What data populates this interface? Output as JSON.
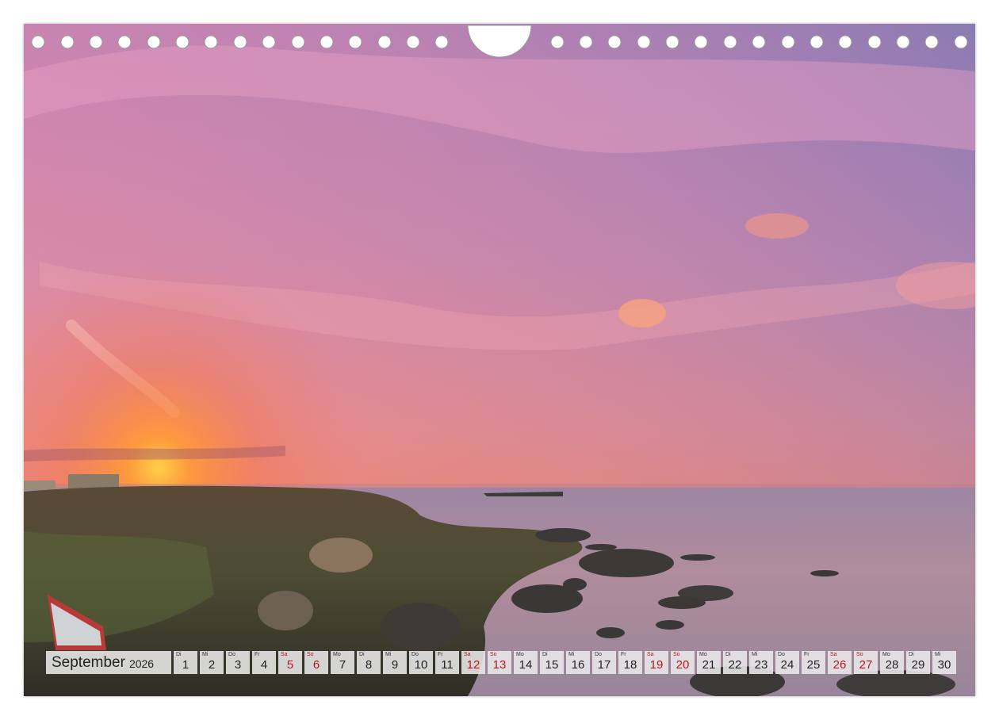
{
  "calendar": {
    "month": "September",
    "year": "2026",
    "weekend_color": "#c0141c",
    "days": [
      {
        "wd": "Di",
        "d": "1",
        "we": false
      },
      {
        "wd": "Mi",
        "d": "2",
        "we": false
      },
      {
        "wd": "Do",
        "d": "3",
        "we": false
      },
      {
        "wd": "Fr",
        "d": "4",
        "we": false
      },
      {
        "wd": "Sa",
        "d": "5",
        "we": true
      },
      {
        "wd": "So",
        "d": "6",
        "we": true
      },
      {
        "wd": "Mo",
        "d": "7",
        "we": false
      },
      {
        "wd": "Di",
        "d": "8",
        "we": false
      },
      {
        "wd": "Mi",
        "d": "9",
        "we": false
      },
      {
        "wd": "Do",
        "d": "10",
        "we": false
      },
      {
        "wd": "Fr",
        "d": "11",
        "we": false
      },
      {
        "wd": "Sa",
        "d": "12",
        "we": true
      },
      {
        "wd": "So",
        "d": "13",
        "we": true
      },
      {
        "wd": "Mo",
        "d": "14",
        "we": false
      },
      {
        "wd": "Di",
        "d": "15",
        "we": false
      },
      {
        "wd": "Mi",
        "d": "16",
        "we": false
      },
      {
        "wd": "Do",
        "d": "17",
        "we": false
      },
      {
        "wd": "Fr",
        "d": "18",
        "we": false
      },
      {
        "wd": "Sa",
        "d": "19",
        "we": true
      },
      {
        "wd": "So",
        "d": "20",
        "we": true
      },
      {
        "wd": "Mo",
        "d": "21",
        "we": false
      },
      {
        "wd": "Di",
        "d": "22",
        "we": false
      },
      {
        "wd": "Mi",
        "d": "23",
        "we": false
      },
      {
        "wd": "Do",
        "d": "24",
        "we": false
      },
      {
        "wd": "Fr",
        "d": "25",
        "we": false
      },
      {
        "wd": "Sa",
        "d": "26",
        "we": true
      },
      {
        "wd": "So",
        "d": "27",
        "we": true
      },
      {
        "wd": "Mo",
        "d": "28",
        "we": false
      },
      {
        "wd": "Di",
        "d": "29",
        "we": false
      },
      {
        "wd": "Mi",
        "d": "30",
        "we": false
      }
    ]
  },
  "photo": {
    "subject": "sunset-over-rocky-coast",
    "colors": {
      "sky_top": "#c97aa6",
      "sky_mid": "#e48a9a",
      "horizon": "#f07a4a",
      "sun": "#ffb640",
      "sea": "#a98a9e",
      "land": "#4b4a36"
    }
  }
}
